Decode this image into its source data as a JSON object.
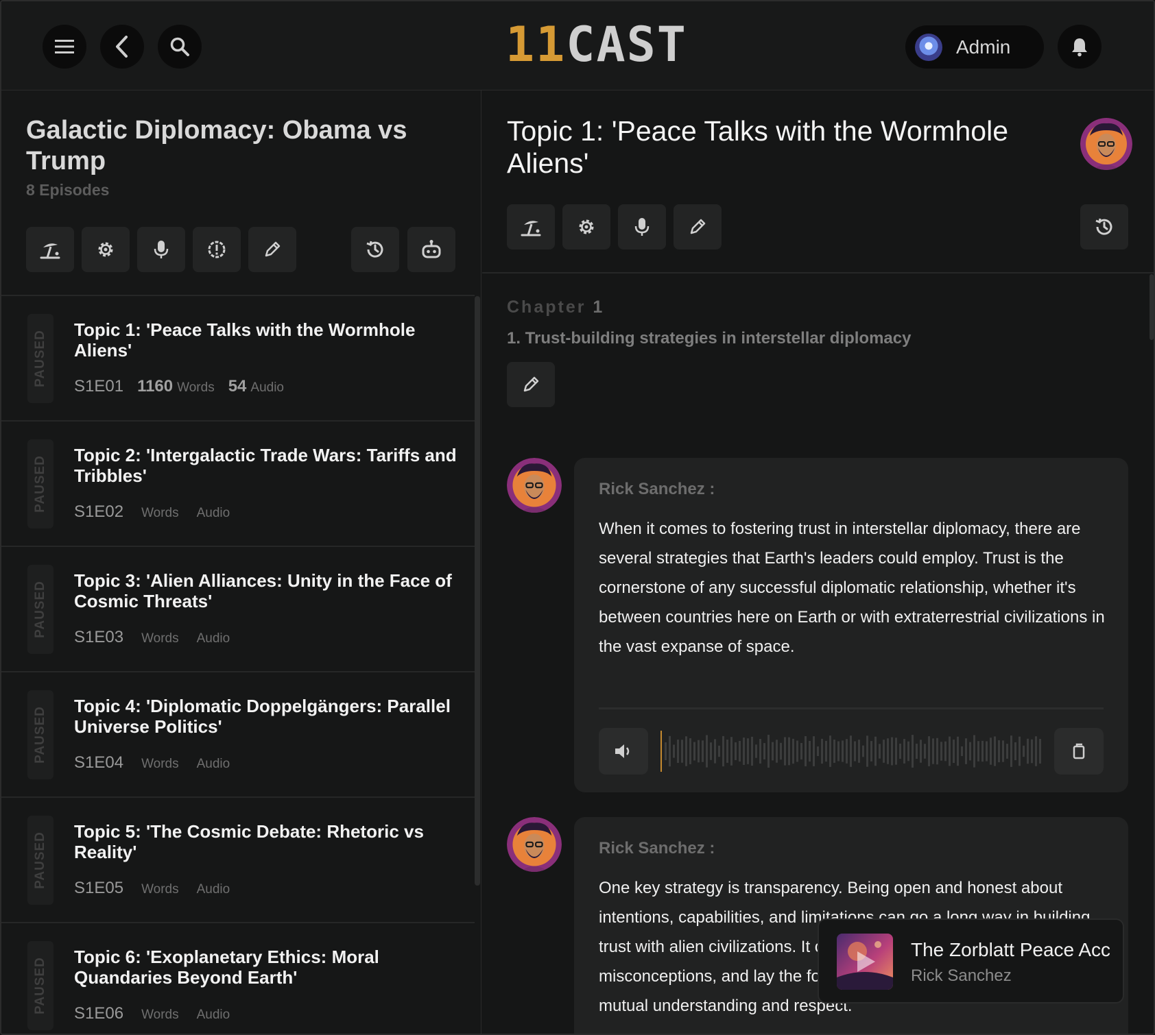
{
  "header": {
    "logo_part1": "11",
    "logo_part2": "CAST",
    "user_name": "Admin",
    "icons": [
      "menu-icon",
      "back-icon",
      "search-icon",
      "bell-icon"
    ]
  },
  "podcast": {
    "title": "Galactic Diplomacy: Obama vs Trump",
    "episodes_count": "8 Episodes",
    "toolbar_icons": [
      "beach-icon",
      "gear-icon",
      "microphone-icon",
      "alert-badge-icon",
      "pencil-icon",
      "history-icon",
      "robot-icon"
    ]
  },
  "episodes": [
    {
      "status": "PAUSED",
      "title": "Topic 1: 'Peace Talks with the Wormhole Aliens'",
      "code": "S1E01",
      "words": "1160",
      "words_label": "Words",
      "audio": "54",
      "audio_label": "Audio"
    },
    {
      "status": "PAUSED",
      "title": "Topic 2: 'Intergalactic Trade Wars: Tariffs and Tribbles'",
      "code": "S1E02",
      "words": "",
      "words_label": "Words",
      "audio": "",
      "audio_label": "Audio"
    },
    {
      "status": "PAUSED",
      "title": "Topic 3: 'Alien Alliances: Unity in the Face of Cosmic Threats'",
      "code": "S1E03",
      "words": "",
      "words_label": "Words",
      "audio": "",
      "audio_label": "Audio"
    },
    {
      "status": "PAUSED",
      "title": "Topic 4: 'Diplomatic Doppelgängers: Parallel Universe Politics'",
      "code": "S1E04",
      "words": "",
      "words_label": "Words",
      "audio": "",
      "audio_label": "Audio"
    },
    {
      "status": "PAUSED",
      "title": "Topic 5: 'The Cosmic Debate: Rhetoric vs Reality'",
      "code": "S1E05",
      "words": "",
      "words_label": "Words",
      "audio": "",
      "audio_label": "Audio"
    },
    {
      "status": "PAUSED",
      "title": "Topic 6: 'Exoplanetary Ethics: Moral Quandaries Beyond Earth'",
      "code": "S1E06",
      "words": "",
      "words_label": "Words",
      "audio": "",
      "audio_label": "Audio"
    }
  ],
  "episode_detail": {
    "title": "Topic 1: 'Peace Talks with the Wormhole Aliens'",
    "toolbar_icons": [
      "beach-icon",
      "gear-icon",
      "microphone-icon",
      "pencil-icon",
      "history-icon"
    ],
    "chapter_label": "Chapter",
    "chapter_number": "1",
    "chapter_title": "1. Trust-building strategies in interstellar diplomacy"
  },
  "messages": [
    {
      "speaker": "Rick Sanchez :",
      "text": "When it comes to fostering trust in interstellar diplomacy, there are several strategies that Earth's leaders could employ. Trust is the cornerstone of any successful diplomatic relationship, whether it's between countries here on Earth or with extraterrestrial civilizations in the vast expanse of space."
    },
    {
      "speaker": "Rick Sanchez :",
      "text": "One key strategy is transparency. Being open and honest about intentions, capabilities, and limitations can go a long way in building trust with alien civilizations. It can help alleviate fears, dispel misconceptions, and lay the foundation for a relationship based on mutual understanding and respect."
    }
  ],
  "mini_player": {
    "title": "The Zorblatt Peace Accord",
    "artist": "Rick Sanchez"
  }
}
